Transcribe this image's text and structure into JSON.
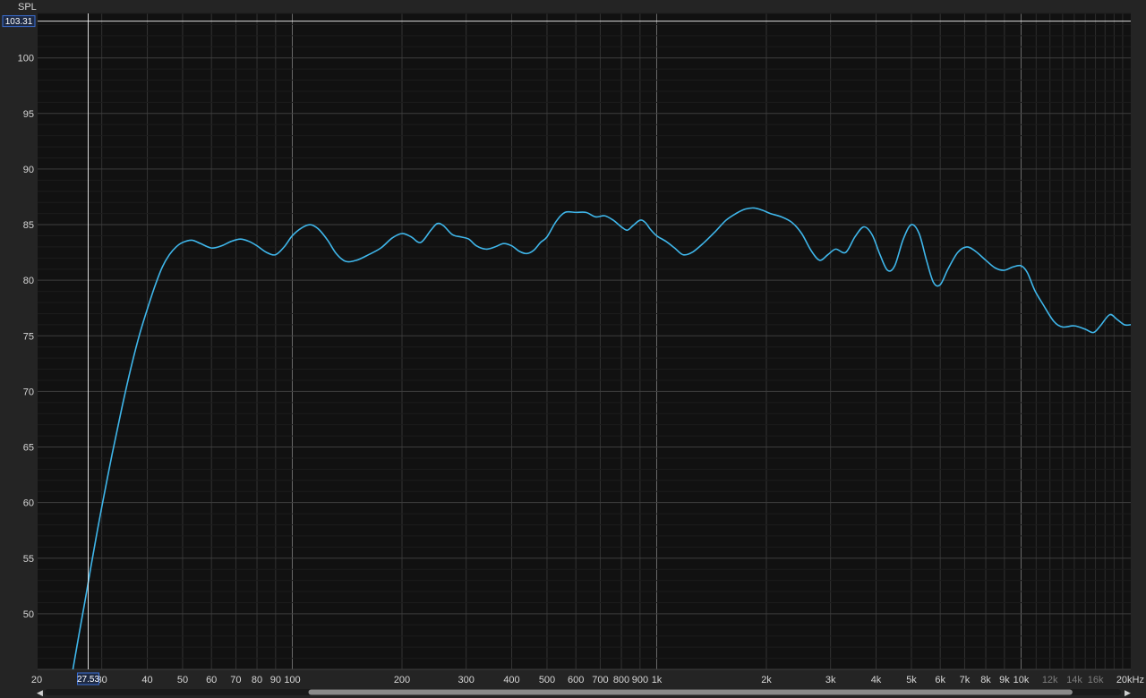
{
  "app": {
    "colors": {
      "background": "#242424",
      "plot_background": "#111111",
      "curve": "#3fb6ea",
      "cursor_line": "#ffffff",
      "readout_border": "#3b6fd6",
      "readout_fill": "#1e2a44"
    },
    "cursor": {
      "x_readout": "27.53",
      "y_readout": "103.31",
      "x_value": 27.53,
      "y_value": 103.31
    },
    "scrollbar": {
      "left_arrow_icon": "triangle-left-icon",
      "right_arrow_icon": "triangle-right-icon",
      "thumb_start_fraction": 0.245,
      "thumb_end_fraction": 0.955
    }
  },
  "chart_data": {
    "type": "line",
    "ylabel": "SPL",
    "x_scale": "log",
    "xlim": [
      20,
      20000
    ],
    "ylim": [
      45,
      104
    ],
    "grid": true,
    "x_ticks": [
      {
        "value": 20,
        "label": "20"
      },
      {
        "value": 30,
        "label": "30"
      },
      {
        "value": 40,
        "label": "40"
      },
      {
        "value": 50,
        "label": "50"
      },
      {
        "value": 60,
        "label": "60"
      },
      {
        "value": 70,
        "label": "70"
      },
      {
        "value": 80,
        "label": "80"
      },
      {
        "value": 90,
        "label": "90"
      },
      {
        "value": 100,
        "label": "100"
      },
      {
        "value": 200,
        "label": "200"
      },
      {
        "value": 300,
        "label": "300"
      },
      {
        "value": 400,
        "label": "400"
      },
      {
        "value": 500,
        "label": "500"
      },
      {
        "value": 600,
        "label": "600"
      },
      {
        "value": 700,
        "label": "700"
      },
      {
        "value": 800,
        "label": "800"
      },
      {
        "value": 900,
        "label": "900"
      },
      {
        "value": 1000,
        "label": "1k"
      },
      {
        "value": 2000,
        "label": "2k"
      },
      {
        "value": 3000,
        "label": "3k"
      },
      {
        "value": 4000,
        "label": "4k"
      },
      {
        "value": 5000,
        "label": "5k"
      },
      {
        "value": 6000,
        "label": "6k"
      },
      {
        "value": 7000,
        "label": "7k"
      },
      {
        "value": 8000,
        "label": "8k"
      },
      {
        "value": 9000,
        "label": "9k"
      },
      {
        "value": 10000,
        "label": "10k"
      },
      {
        "value": 12000,
        "label": "12k",
        "dim": true
      },
      {
        "value": 14000,
        "label": "14k",
        "dim": true
      },
      {
        "value": 16000,
        "label": "16k",
        "dim": true
      },
      {
        "value": 20000,
        "label": "20kHz"
      }
    ],
    "y_ticks": [
      {
        "value": 50,
        "label": "50"
      },
      {
        "value": 55,
        "label": "55"
      },
      {
        "value": 60,
        "label": "60"
      },
      {
        "value": 65,
        "label": "65"
      },
      {
        "value": 70,
        "label": "70"
      },
      {
        "value": 75,
        "label": "75"
      },
      {
        "value": 80,
        "label": "80"
      },
      {
        "value": 85,
        "label": "85"
      },
      {
        "value": 90,
        "label": "90"
      },
      {
        "value": 95,
        "label": "95"
      },
      {
        "value": 100,
        "label": "100"
      }
    ],
    "series": [
      {
        "points": [
          [
            25,
            45
          ],
          [
            26,
            48.2
          ],
          [
            27,
            51.2
          ],
          [
            28,
            54.2
          ],
          [
            29,
            57
          ],
          [
            30,
            59.6
          ],
          [
            32,
            64.3
          ],
          [
            34,
            68.4
          ],
          [
            36,
            72
          ],
          [
            38,
            75
          ],
          [
            40,
            77.4
          ],
          [
            42,
            79.5
          ],
          [
            44,
            81.2
          ],
          [
            46,
            82.3
          ],
          [
            48,
            83
          ],
          [
            50,
            83.4
          ],
          [
            53,
            83.6
          ],
          [
            56,
            83.3
          ],
          [
            60,
            82.9
          ],
          [
            64,
            83.1
          ],
          [
            68,
            83.5
          ],
          [
            72,
            83.7
          ],
          [
            76,
            83.5
          ],
          [
            80,
            83.1
          ],
          [
            85,
            82.5
          ],
          [
            90,
            82.3
          ],
          [
            95,
            83
          ],
          [
            100,
            84
          ],
          [
            106,
            84.7
          ],
          [
            112,
            85
          ],
          [
            118,
            84.6
          ],
          [
            125,
            83.6
          ],
          [
            132,
            82.4
          ],
          [
            140,
            81.7
          ],
          [
            150,
            81.8
          ],
          [
            162,
            82.3
          ],
          [
            175,
            82.9
          ],
          [
            188,
            83.8
          ],
          [
            200,
            84.2
          ],
          [
            212,
            83.9
          ],
          [
            225,
            83.4
          ],
          [
            240,
            84.5
          ],
          [
            250,
            85.1
          ],
          [
            260,
            84.9
          ],
          [
            275,
            84.1
          ],
          [
            290,
            83.9
          ],
          [
            305,
            83.7
          ],
          [
            320,
            83.1
          ],
          [
            340,
            82.8
          ],
          [
            360,
            83
          ],
          [
            380,
            83.3
          ],
          [
            400,
            83.1
          ],
          [
            420,
            82.6
          ],
          [
            440,
            82.4
          ],
          [
            460,
            82.7
          ],
          [
            480,
            83.4
          ],
          [
            500,
            83.9
          ],
          [
            530,
            85.3
          ],
          [
            560,
            86.1
          ],
          [
            600,
            86.1
          ],
          [
            640,
            86.1
          ],
          [
            680,
            85.7
          ],
          [
            720,
            85.8
          ],
          [
            760,
            85.4
          ],
          [
            800,
            84.8
          ],
          [
            830,
            84.5
          ],
          [
            860,
            84.9
          ],
          [
            900,
            85.4
          ],
          [
            930,
            85.2
          ],
          [
            960,
            84.6
          ],
          [
            1000,
            84
          ],
          [
            1060,
            83.5
          ],
          [
            1120,
            82.9
          ],
          [
            1180,
            82.3
          ],
          [
            1250,
            82.5
          ],
          [
            1350,
            83.4
          ],
          [
            1450,
            84.4
          ],
          [
            1550,
            85.4
          ],
          [
            1650,
            86
          ],
          [
            1750,
            86.4
          ],
          [
            1850,
            86.5
          ],
          [
            1950,
            86.3
          ],
          [
            2050,
            86
          ],
          [
            2200,
            85.7
          ],
          [
            2350,
            85.2
          ],
          [
            2500,
            84.2
          ],
          [
            2650,
            82.7
          ],
          [
            2800,
            81.8
          ],
          [
            2950,
            82.3
          ],
          [
            3100,
            82.8
          ],
          [
            3300,
            82.5
          ],
          [
            3500,
            83.9
          ],
          [
            3700,
            84.8
          ],
          [
            3900,
            84.1
          ],
          [
            4100,
            82.3
          ],
          [
            4300,
            80.9
          ],
          [
            4500,
            81.3
          ],
          [
            4750,
            83.7
          ],
          [
            5000,
            85
          ],
          [
            5250,
            84.2
          ],
          [
            5500,
            81.8
          ],
          [
            5750,
            79.8
          ],
          [
            6000,
            79.6
          ],
          [
            6300,
            81
          ],
          [
            6700,
            82.5
          ],
          [
            7100,
            83
          ],
          [
            7500,
            82.6
          ],
          [
            8000,
            81.8
          ],
          [
            8500,
            81.1
          ],
          [
            9000,
            80.9
          ],
          [
            9500,
            81.2
          ],
          [
            10000,
            81.3
          ],
          [
            10400,
            80.7
          ],
          [
            10900,
            79.1
          ],
          [
            11500,
            77.8
          ],
          [
            12300,
            76.3
          ],
          [
            13000,
            75.8
          ],
          [
            14000,
            75.9
          ],
          [
            15000,
            75.6
          ],
          [
            15800,
            75.3
          ],
          [
            16500,
            75.9
          ],
          [
            17500,
            76.9
          ],
          [
            18300,
            76.5
          ],
          [
            19200,
            76
          ],
          [
            20000,
            76
          ]
        ]
      }
    ]
  }
}
